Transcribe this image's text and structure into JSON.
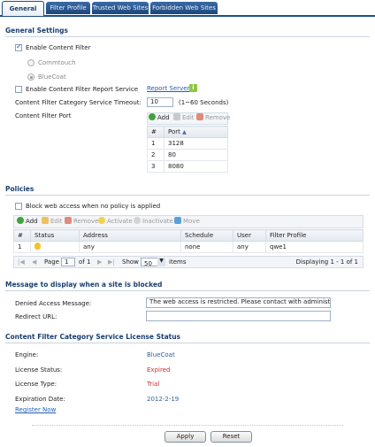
{
  "tabs": [
    "General",
    "Filter Profile",
    "Trusted Web Sites",
    "Forbidden Web Sites"
  ],
  "general": {
    "title": "General Settings",
    "enable_content_filter": "Enable Content Filter",
    "commtouch": "Commtouch",
    "bluecoat": "BlueCoat",
    "enable_report_service": "Enable Content Filter Report Service",
    "report_server": "Report Server",
    "timeout_label": "Content Filter Category Service Timeout:",
    "timeout_value": "10",
    "timeout_hint": "(1~60 Seconds)",
    "port_label": "Content Filter Port",
    "port_toolbar": {
      "add": "Add",
      "edit": "Edit",
      "remove": "Remove"
    },
    "port_table": {
      "headers": [
        "#",
        "Port"
      ],
      "rows": [
        [
          "1",
          "3128"
        ],
        [
          "2",
          "80"
        ],
        [
          "3",
          "8080"
        ]
      ]
    }
  },
  "policies": {
    "title": "Policies",
    "block_label": "Block web access when no policy is applied",
    "toolbar": {
      "add": "Add",
      "edit": "Edit",
      "remove": "Remove",
      "activate": "Activate",
      "inactivate": "Inactivate",
      "move": "Move"
    },
    "table": {
      "headers": [
        "#",
        "Status",
        "Address",
        "Schedule",
        "User",
        "Filter Profile"
      ],
      "rows": [
        [
          "1",
          "",
          "any",
          "none",
          "any",
          "qwe1"
        ]
      ]
    },
    "pager": {
      "page_label": "Page",
      "page_value": "1",
      "of_label": "of 1",
      "show_label": "Show",
      "show_value": "50",
      "items_label": "items",
      "displaying": "Displaying 1 - 1 of 1"
    }
  },
  "message": {
    "title": "Message to display when a site is blocked",
    "denied_label": "Denied Access Message:",
    "denied_value": "The web access is restricted. Please contact with administrator.",
    "redirect_label": "Redirect URL:",
    "redirect_value": ""
  },
  "license": {
    "title": "Content Filter Category Service License Status",
    "engine_label": "Engine:",
    "engine_value": "BlueCoat",
    "status_label": "License Status:",
    "status_value": "Expired",
    "type_label": "License Type:",
    "type_value": "Trial",
    "expiration_label": "Expiration Date:",
    "expiration_value": "2012-2-19",
    "register": "Register Now"
  },
  "footer": {
    "apply": "Apply",
    "reset": "Reset"
  },
  "colors": {
    "accent": "#1f4d86",
    "link": "#1f5fb5",
    "expired": "#d22b2b"
  }
}
